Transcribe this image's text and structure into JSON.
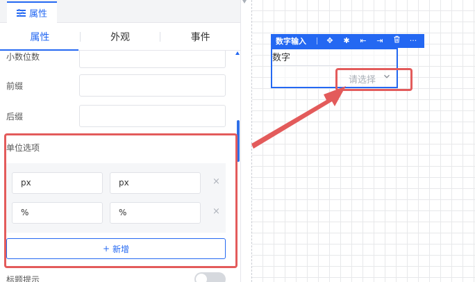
{
  "panel": {
    "tab_label": "属性",
    "subtabs": [
      "属性",
      "外观",
      "事件"
    ],
    "fields": {
      "decimal_places_label": "小数位数",
      "prefix_label": "前缀",
      "suffix_label": "后缀"
    },
    "unit_options": {
      "label": "单位选项",
      "rows": [
        {
          "value": "px",
          "label": "px"
        },
        {
          "value": "%",
          "label": "%"
        }
      ],
      "remove_glyph": "×",
      "add_button": "新增",
      "add_icon": "+"
    },
    "label_tip": "标题提示"
  },
  "canvas": {
    "toolbar": {
      "title": "数字输入",
      "icons": [
        "move-icon",
        "bug-icon",
        "insert-before-icon",
        "insert-after-icon",
        "delete-icon",
        "more-icon"
      ],
      "glyphs": [
        "✥",
        "✱",
        "⇤",
        "⇥",
        "🗑",
        "···"
      ]
    },
    "component": {
      "label": "数字",
      "select_placeholder": "请选择",
      "chevron": "⌄"
    }
  },
  "colors": {
    "accent": "#2468f2",
    "highlight": "#e35b5b"
  }
}
